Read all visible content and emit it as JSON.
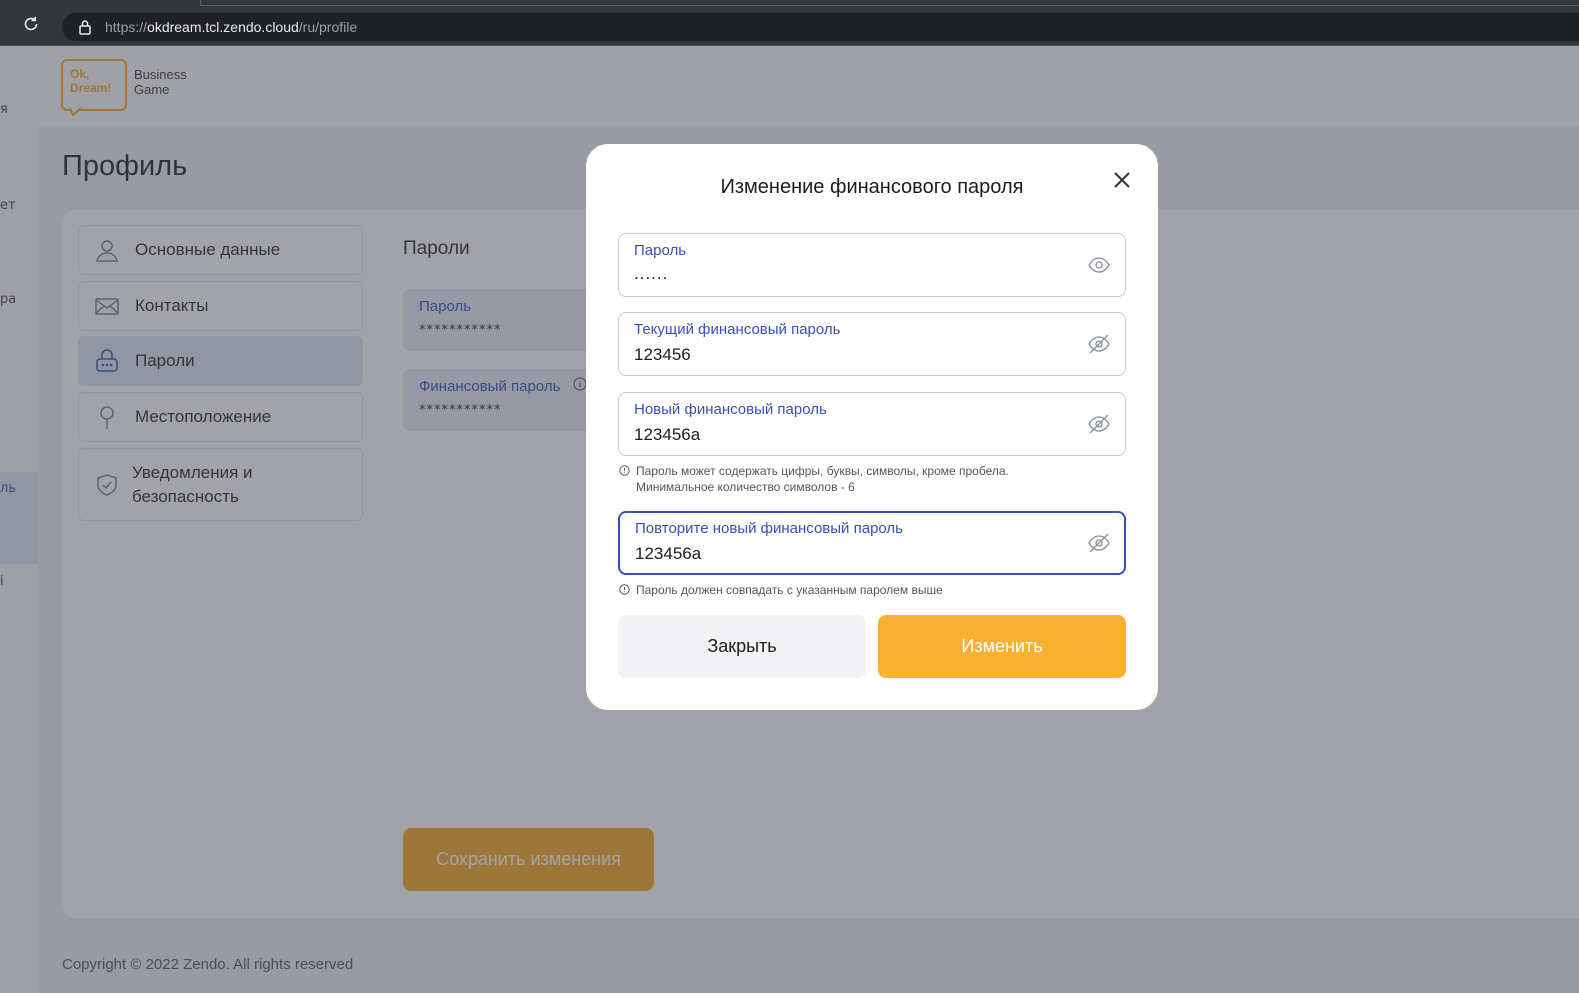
{
  "browser": {
    "url_scheme": "https://",
    "url_host": "okdream.tcl.zendo.cloud",
    "url_path": "/ru/profile"
  },
  "leftnav": {
    "fragments": [
      "я",
      "ет",
      "ра",
      "ль",
      "і"
    ]
  },
  "logo": {
    "badge_line1": "Ok,",
    "badge_line2": "Dream!",
    "sub_line1": "Business",
    "sub_line2": "Game",
    "brand_color": "#f5a623"
  },
  "page": {
    "title": "Профиль",
    "section_title": "Пароли",
    "save_label": "Сохранить изменения",
    "footer": "Copyright © 2022 Zendo. All rights reserved"
  },
  "menu": [
    {
      "label": "Основные данные",
      "icon": "user-icon"
    },
    {
      "label": "Контакты",
      "icon": "envelope-icon"
    },
    {
      "label": "Пароли",
      "icon": "lock-icon"
    },
    {
      "label": "Местоположение",
      "icon": "location-pin-icon"
    },
    {
      "label": "Уведомления и безопасность",
      "icon": "shield-icon"
    }
  ],
  "passwords": {
    "password_label": "Пароль",
    "password_value": "***********",
    "fin_password_label": "Финансовый пароль",
    "fin_password_value": "***********"
  },
  "modal": {
    "title": "Изменение финансового пароля",
    "fields": [
      {
        "label": "Пароль",
        "value": "......"
      },
      {
        "label": "Текущий финансовый пароль",
        "value": "123456"
      },
      {
        "label": "Новый финансовый пароль",
        "value": "123456a"
      },
      {
        "label": "Повторите новый финансовый пароль",
        "value": "123456a"
      }
    ],
    "hint_new_line1": "Пароль может содержать цифры, буквы, символы, кроме пробела.",
    "hint_new_line2": "Минимальное количество символов - 6",
    "hint_repeat": "Пароль должен совпадать с указанным паролем выше",
    "close_label": "Закрыть",
    "change_label": "Изменить",
    "accent_color": "#f8b133",
    "focus_color": "#3550b8"
  }
}
